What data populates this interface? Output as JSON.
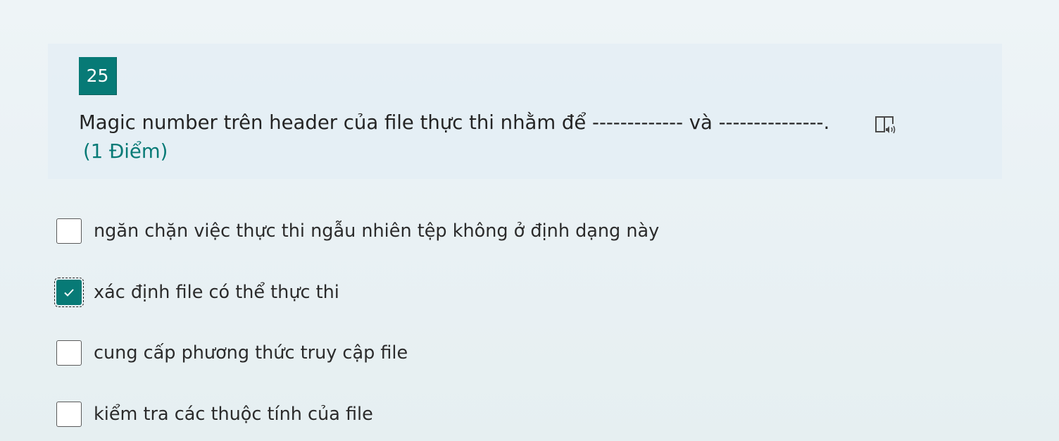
{
  "question": {
    "number": "25",
    "text": "Magic number trên header của file thực thi nhằm để ------------- và ---------------.",
    "points": "(1 Điểm)",
    "reader_icon": "immersive-reader-icon"
  },
  "options": [
    {
      "label": "ngăn chặn việc thực thi ngẫu nhiên tệp không ở định dạng này",
      "checked": false
    },
    {
      "label": "xác định file có thể thực thi",
      "checked": true
    },
    {
      "label": "cung cấp phương thức truy cập file",
      "checked": false
    },
    {
      "label": "kiểm tra các thuộc tính của file",
      "checked": false
    }
  ],
  "colors": {
    "accent": "#077a76",
    "text": "#242424",
    "background": "#eef4f7"
  }
}
